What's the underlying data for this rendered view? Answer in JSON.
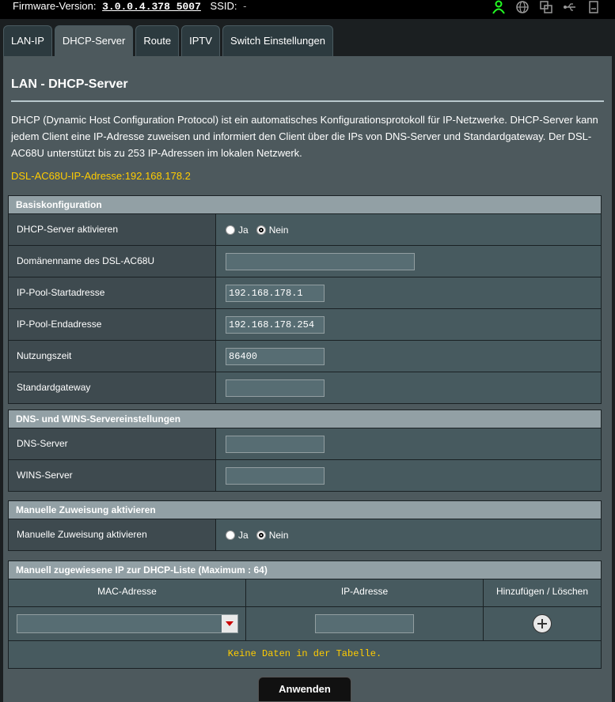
{
  "topbar": {
    "firmware_label": "Firmware-Version:",
    "firmware_version": "3.0.0.4.378_5007",
    "ssid_label": "SSID:",
    "ssid_value": "-"
  },
  "tabs": [
    {
      "label": "LAN-IP"
    },
    {
      "label": "DHCP-Server"
    },
    {
      "label": "Route"
    },
    {
      "label": "IPTV"
    },
    {
      "label": "Switch Einstellungen"
    }
  ],
  "page": {
    "title": "LAN - DHCP-Server",
    "description": "DHCP (Dynamic Host Configuration Protocol) ist ein automatisches Konfigurationsprotokoll für IP-Netzwerke. DHCP-Server kann jedem Client eine IP-Adresse zuweisen und informiert den Client über die IPs von DNS-Server und Standardgateway. Der DSL-AC68U unterstützt bis zu 253 IP-Adressen im lokalen Netzwerk.",
    "ip_line": "DSL-AC68U-IP-Adresse:192.168.178.2"
  },
  "basis": {
    "header": "Basiskonfiguration",
    "dhcp_label": "DHCP-Server aktivieren",
    "yes": "Ja",
    "no": "Nein",
    "domain_label": "Domänenname des DSL-AC68U",
    "domain_value": "",
    "start_label": "IP-Pool-Startadresse",
    "start_value": "192.168.178.1",
    "end_label": "IP-Pool-Endadresse",
    "end_value": "192.168.178.254",
    "lease_label": "Nutzungszeit",
    "lease_value": "86400",
    "gateway_label": "Standardgateway",
    "gateway_value": ""
  },
  "dns": {
    "header": "DNS- und WINS-Servereinstellungen",
    "dns_label": "DNS-Server",
    "dns_value": "",
    "wins_label": "WINS-Server",
    "wins_value": ""
  },
  "manual": {
    "header": "Manuelle Zuweisung aktivieren",
    "label": "Manuelle Zuweisung aktivieren",
    "yes": "Ja",
    "no": "Nein"
  },
  "list": {
    "header": "Manuell zugewiesene IP zur DHCP-Liste (Maximum : 64)",
    "col_mac": "MAC-Adresse",
    "col_ip": "IP-Adresse",
    "col_action": "Hinzufügen / Löschen",
    "empty": "Keine Daten in der Tabelle."
  },
  "apply_label": "Anwenden",
  "colors": {
    "accent": "#ffcc00",
    "panel": "#4d595d"
  }
}
